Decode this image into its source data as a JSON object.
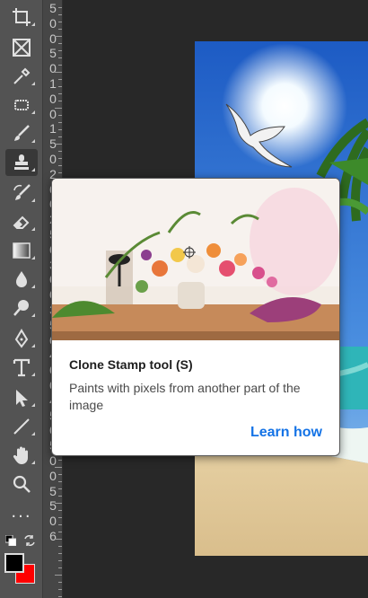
{
  "toolbar": {
    "tools": [
      {
        "name": "crop-tool",
        "icon": "crop-icon",
        "active": false
      },
      {
        "name": "frame-tool",
        "icon": "frame-icon",
        "active": false
      },
      {
        "name": "eyedropper-tool",
        "icon": "eyedropper-icon",
        "active": false
      },
      {
        "name": "spot-healing-tool",
        "icon": "bandage-icon",
        "active": false
      },
      {
        "name": "brush-tool",
        "icon": "brush-icon",
        "active": false
      },
      {
        "name": "clone-stamp-tool",
        "icon": "stamp-icon",
        "active": true
      },
      {
        "name": "history-brush-tool",
        "icon": "history-brush-icon",
        "active": false
      },
      {
        "name": "eraser-tool",
        "icon": "eraser-icon",
        "active": false
      },
      {
        "name": "gradient-tool",
        "icon": "gradient-icon",
        "active": false
      },
      {
        "name": "blur-tool",
        "icon": "drop-icon",
        "active": false
      },
      {
        "name": "dodge-tool",
        "icon": "dodge-icon",
        "active": false
      },
      {
        "name": "pen-tool",
        "icon": "pen-icon",
        "active": false
      },
      {
        "name": "type-tool",
        "icon": "type-icon",
        "active": false
      },
      {
        "name": "path-selection-tool",
        "icon": "arrow-icon",
        "active": false
      },
      {
        "name": "line-tool",
        "icon": "line-icon",
        "active": false
      },
      {
        "name": "hand-tool",
        "icon": "hand-icon",
        "active": false
      },
      {
        "name": "zoom-tool",
        "icon": "magnifier-icon",
        "active": false
      },
      {
        "name": "more-tools",
        "icon": "ellipsis-icon",
        "active": false
      }
    ],
    "more_label": "...",
    "foreground_color": "#000000",
    "background_color": "#ff0000"
  },
  "ruler": {
    "digits": [
      "5",
      "0",
      "0",
      "5",
      "0",
      "1",
      "0",
      "0",
      "1",
      "5",
      "0",
      "2",
      "0",
      "0",
      "2",
      "5",
      "0",
      "3",
      "0",
      "0",
      "3",
      "5",
      "0",
      "4",
      "0",
      "0",
      "4",
      "5",
      "0",
      "5",
      "0",
      "0",
      "5",
      "5",
      "0",
      "6"
    ]
  },
  "tooltip": {
    "title": "Clone Stamp tool (S)",
    "description": "Paints with pixels from another part of the image",
    "link_label": "Learn how",
    "link_color": "#1473e6"
  },
  "canvas": {
    "description_colors": {
      "sky": "#2d6fd0",
      "sand": "#e8d3a8",
      "sea": "#2fb5b8"
    }
  }
}
